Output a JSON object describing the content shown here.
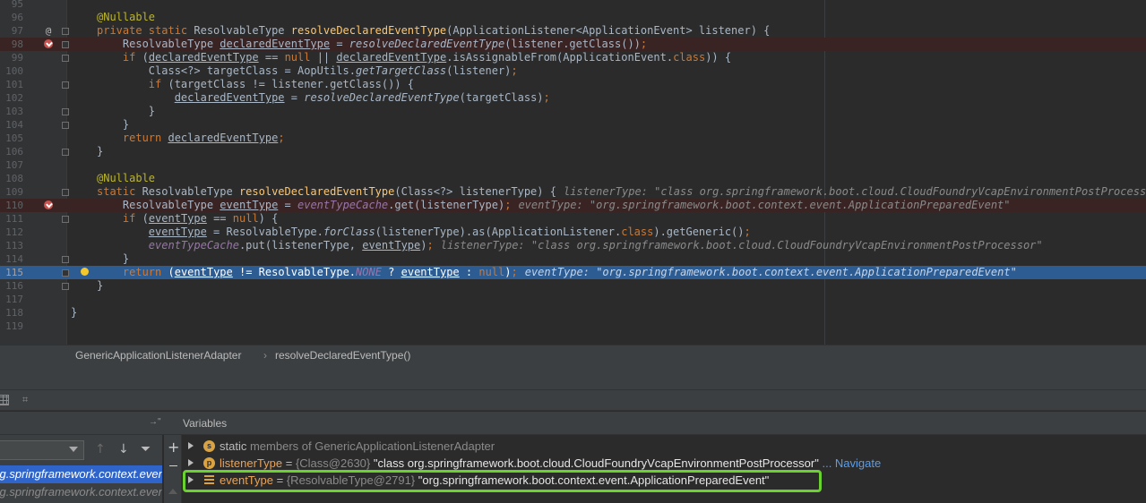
{
  "editor": {
    "lines": [
      {
        "n": "95",
        "kind": "plain",
        "html_segments": []
      },
      {
        "n": "96",
        "kind": "plain",
        "segs": [
          [
            "an",
            "@Nullable"
          ]
        ]
      },
      {
        "n": "97",
        "kind": "plain",
        "gutter": "@",
        "fold": true,
        "segs": [
          [
            "kw",
            "private static "
          ],
          [
            "",
            "ResolvableType "
          ],
          [
            "fn",
            "resolveDeclaredEventType"
          ],
          [
            "",
            "(ApplicationListener<ApplicationEvent> listener) {"
          ]
        ]
      },
      {
        "n": "98",
        "kind": "bp",
        "fold": true,
        "segs": [
          [
            "",
            "    ResolvableType "
          ],
          [
            "ul",
            "declaredEventType"
          ],
          [
            "",
            " = "
          ],
          [
            "it",
            "resolveDeclaredEventType"
          ],
          [
            "",
            "(listener.getClass())"
          ],
          [
            "kw",
            ";"
          ]
        ]
      },
      {
        "n": "99",
        "kind": "plain",
        "fold": true,
        "segs": [
          [
            "",
            "    "
          ],
          [
            "kw",
            "if "
          ],
          [
            "",
            "("
          ],
          [
            "ul",
            "declaredEventType"
          ],
          [
            "",
            " == "
          ],
          [
            "kw",
            "null "
          ],
          [
            "",
            "|| "
          ],
          [
            "ul",
            "declaredEventType"
          ],
          [
            "",
            ".isAssignableFrom(ApplicationEvent."
          ],
          [
            "kw",
            "class"
          ],
          [
            "",
            ")) {"
          ]
        ]
      },
      {
        "n": "100",
        "kind": "plain",
        "segs": [
          [
            "",
            "        Class<?> targetClass = AopUtils."
          ],
          [
            "it",
            "getTargetClass"
          ],
          [
            "",
            "(listener)"
          ],
          [
            "kw",
            ";"
          ]
        ]
      },
      {
        "n": "101",
        "kind": "plain",
        "fold": true,
        "segs": [
          [
            "",
            "        "
          ],
          [
            "kw",
            "if "
          ],
          [
            "",
            "(targetClass != listener.getClass()) {"
          ]
        ]
      },
      {
        "n": "102",
        "kind": "plain",
        "segs": [
          [
            "",
            "            "
          ],
          [
            "ul",
            "declaredEventType"
          ],
          [
            "",
            " = "
          ],
          [
            "it",
            "resolveDeclaredEventType"
          ],
          [
            "",
            "(targetClass)"
          ],
          [
            "kw",
            ";"
          ]
        ]
      },
      {
        "n": "103",
        "kind": "plain",
        "fold": true,
        "segs": [
          [
            "",
            "        }"
          ]
        ]
      },
      {
        "n": "104",
        "kind": "plain",
        "fold": true,
        "segs": [
          [
            "",
            "    }"
          ]
        ]
      },
      {
        "n": "105",
        "kind": "plain",
        "segs": [
          [
            "",
            "    "
          ],
          [
            "kw",
            "return "
          ],
          [
            "ul",
            "declaredEventType"
          ],
          [
            "kw",
            ";"
          ]
        ]
      },
      {
        "n": "106",
        "kind": "plain",
        "fold": true,
        "segs": [
          [
            "",
            "}"
          ]
        ]
      },
      {
        "n": "107",
        "kind": "plain",
        "segs": []
      },
      {
        "n": "108",
        "kind": "plain",
        "segs": [
          [
            "an",
            "@Nullable"
          ]
        ]
      },
      {
        "n": "109",
        "kind": "plain",
        "fold": true,
        "segs": [
          [
            "kw",
            "static "
          ],
          [
            "",
            "ResolvableType "
          ],
          [
            "fn",
            "resolveDeclaredEventType"
          ],
          [
            "",
            "(Class<?> listenerType) {"
          ]
        ],
        "hint": "listenerType: \"class org.springframework.boot.cloud.CloudFoundryVcapEnvironmentPostProcessor\""
      },
      {
        "n": "110",
        "kind": "bp",
        "segs": [
          [
            "",
            "    ResolvableType "
          ],
          [
            "ul",
            "eventType"
          ],
          [
            "",
            " = "
          ],
          [
            "fld it",
            "eventTypeCache"
          ],
          [
            "",
            ".get(listenerType)"
          ],
          [
            "kw",
            ";"
          ]
        ],
        "hint": "eventType: \"org.springframework.boot.context.event.ApplicationPreparedEvent\""
      },
      {
        "n": "111",
        "kind": "plain",
        "fold": true,
        "segs": [
          [
            "",
            "    "
          ],
          [
            "kw",
            "if "
          ],
          [
            "",
            "("
          ],
          [
            "ul",
            "eventType"
          ],
          [
            "",
            " == "
          ],
          [
            "kw",
            "null"
          ],
          [
            "",
            ") {"
          ]
        ]
      },
      {
        "n": "112",
        "kind": "plain",
        "segs": [
          [
            "",
            "        "
          ],
          [
            "ul",
            "eventType"
          ],
          [
            "",
            " = ResolvableType."
          ],
          [
            "it",
            "forClass"
          ],
          [
            "",
            "(listenerType).as(ApplicationListener."
          ],
          [
            "kw",
            "class"
          ],
          [
            "",
            ").getGeneric()"
          ],
          [
            "kw",
            ";"
          ]
        ]
      },
      {
        "n": "113",
        "kind": "plain",
        "segs": [
          [
            "",
            "        "
          ],
          [
            "fld it",
            "eventTypeCache"
          ],
          [
            "",
            ".put(listenerType, "
          ],
          [
            "ul",
            "eventType"
          ],
          [
            "",
            ")"
          ],
          [
            "kw",
            ";"
          ]
        ],
        "hint": "listenerType: \"class org.springframework.boot.cloud.CloudFoundryVcapEnvironmentPostProcessor\""
      },
      {
        "n": "114",
        "kind": "plain",
        "fold": true,
        "segs": [
          [
            "",
            "    }"
          ]
        ]
      },
      {
        "n": "115",
        "kind": "cur",
        "fold": true,
        "segs": [
          [
            "",
            "    "
          ],
          [
            "kw",
            "return "
          ],
          [
            "",
            "("
          ],
          [
            "ul",
            "eventType"
          ],
          [
            "",
            " != ResolvableType."
          ],
          [
            "fld it",
            "NONE"
          ],
          [
            "",
            " ? "
          ],
          [
            "ul",
            "eventType"
          ],
          [
            "",
            " : "
          ],
          [
            "kw",
            "null"
          ],
          [
            "",
            ")"
          ],
          [
            "kw",
            ";"
          ]
        ],
        "hint": "eventType: \"org.springframework.boot.context.event.ApplicationPreparedEvent\""
      },
      {
        "n": "116",
        "kind": "plain",
        "fold": true,
        "segs": [
          [
            "",
            "}"
          ]
        ]
      },
      {
        "n": "117",
        "kind": "plain",
        "segs": []
      },
      {
        "n": "118",
        "kind": "plain",
        "segs": [
          [
            "",
            "}"
          ]
        ],
        "indent_back": true
      },
      {
        "n": "119",
        "kind": "plain",
        "segs": []
      }
    ]
  },
  "breadcrumb": {
    "class_name": "GenericApplicationListenerAdapter",
    "separator": "›",
    "method_name": "resolveDeclaredEventType()"
  },
  "variables_panel": {
    "title": "Variables",
    "pin_glyph": "→\"",
    "add_glyph": "+"
  },
  "frames": {
    "rows": [
      {
        "text": "org.springframework.context.event",
        "selected": true
      },
      {
        "text": "org.springframework.context.event",
        "selected": false
      }
    ]
  },
  "variables": [
    {
      "badge": "s",
      "name": "static",
      "name_style": "plain",
      "type": "",
      "value": "members of GenericApplicationListenerAdapter",
      "link": ""
    },
    {
      "badge": "p",
      "name": "listenerType",
      "name_style": "orange",
      "type": "{Class@2630}",
      "value": "\"class org.springframework.boot.cloud.CloudFoundryVcapEnvironmentPostProcessor\"",
      "link": "... Navigate"
    },
    {
      "badge": "stack",
      "name": "eventType",
      "name_style": "orange",
      "type": "{ResolvableType@2791}",
      "value": "\"org.springframework.boot.context.event.ApplicationPreparedEvent\"",
      "link": ""
    }
  ],
  "colors": {
    "editor_bg": "#2b2b2b",
    "current_line": "#2d5c93",
    "breakpoint_line": "#3a2323",
    "highlight_box": "#6bd12f"
  },
  "icons": {
    "breakpoint": "breakpoint-check-icon",
    "bulb": "intention-bulb-icon",
    "override": "at-sign-icon"
  }
}
